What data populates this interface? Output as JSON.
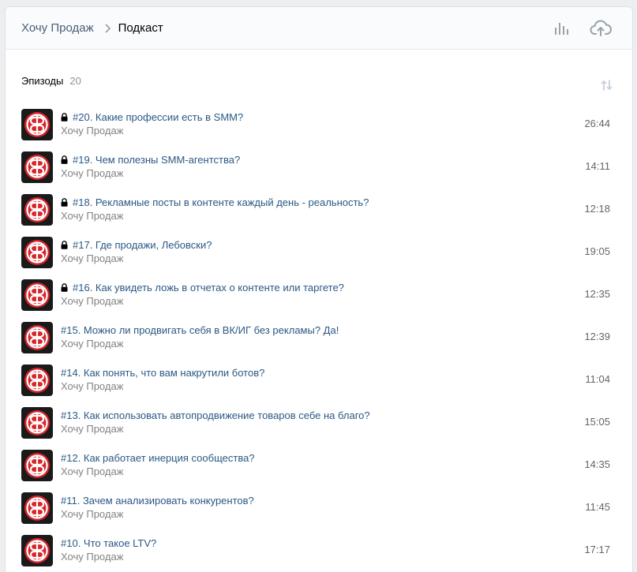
{
  "header": {
    "breadcrumb_parent": "Хочу Продаж",
    "breadcrumb_current": "Подкаст",
    "stats_icon": "bar-chart-icon",
    "upload_icon": "cloud-upload-icon"
  },
  "section": {
    "title": "Эпизоды",
    "count": "20",
    "sort_icon": "sort-icon"
  },
  "colors": {
    "accent_link": "#2a5885",
    "cover_red": "#d6252b"
  },
  "episodes": [
    {
      "title": "#20. Какие профессии есть в SMM?",
      "author": "Хочу Продаж",
      "duration": "26:44",
      "locked": true
    },
    {
      "title": "#19. Чем полезны SMM-агентства?",
      "author": "Хочу Продаж",
      "duration": "14:11",
      "locked": true
    },
    {
      "title": "#18. Рекламные посты в контенте каждый день - реальность?",
      "author": "Хочу Продаж",
      "duration": "12:18",
      "locked": true
    },
    {
      "title": "#17. Где продажи, Лебовски?",
      "author": "Хочу Продаж",
      "duration": "19:05",
      "locked": true
    },
    {
      "title": "#16. Как увидеть ложь в отчетах о контенте или таргете?",
      "author": "Хочу Продаж",
      "duration": "12:35",
      "locked": true
    },
    {
      "title": "#15. Можно ли продвигать себя в ВК/ИГ без рекламы? Да!",
      "author": "Хочу Продаж",
      "duration": "12:39",
      "locked": false
    },
    {
      "title": "#14. Как понять, что вам накрутили ботов?",
      "author": "Хочу Продаж",
      "duration": "11:04",
      "locked": false
    },
    {
      "title": "#13. Как использовать автопродвижение товаров себе на благо?",
      "author": "Хочу Продаж",
      "duration": "15:05",
      "locked": false
    },
    {
      "title": "#12. Как работает инерция сообщества?",
      "author": "Хочу Продаж",
      "duration": "14:35",
      "locked": false
    },
    {
      "title": "#11. Зачем анализировать конкурентов?",
      "author": "Хочу Продаж",
      "duration": "11:45",
      "locked": false
    },
    {
      "title": "#10. Что такое LTV?",
      "author": "Хочу Продаж",
      "duration": "17:17",
      "locked": false
    }
  ]
}
